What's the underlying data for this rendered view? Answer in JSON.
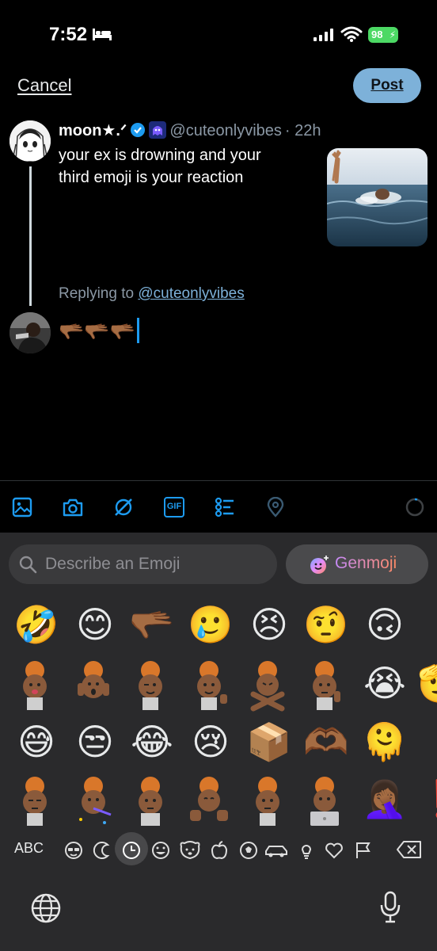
{
  "status_bar": {
    "time": "7:52",
    "battery": "98",
    "icons": [
      "bed-icon",
      "signal-icon",
      "wifi-icon",
      "battery-icon"
    ]
  },
  "header": {
    "cancel_label": "Cancel",
    "post_label": "Post"
  },
  "tweet": {
    "display_name": "moon★.ᐟ",
    "handle": "@cuteonlyvibes",
    "time_ago": "· 22h",
    "text_line1": "your ex is drowning and your",
    "text_line2": "third emoji is your reaction",
    "replying_prefix": "Replying to",
    "replying_handle": "@cuteonlyvibes"
  },
  "reply": {
    "text": "🫳🏾🫳🏾🫳🏾"
  },
  "toolbar": {
    "icons": [
      "image-icon",
      "camera-icon",
      "grok-icon",
      "gif-icon",
      "poll-icon",
      "location-icon",
      "character-count-ring"
    ],
    "gif_label": "GIF"
  },
  "keyboard": {
    "search_placeholder": "Describe an Emoji",
    "genmoji_label": "Genmoji",
    "abc_label": "ABC",
    "emoji_rows": [
      [
        "🤣",
        "😊",
        "🫳🏾",
        "🥲",
        "😣",
        "🤨",
        "🙃"
      ],
      [
        "memoji",
        "memoji",
        "memoji",
        "memoji",
        "memoji",
        "memoji",
        "😭",
        "🫡"
      ],
      [
        "😅",
        "😒",
        "😂",
        "😢",
        "📦",
        "🫶🏾",
        "🫠"
      ],
      [
        "memoji",
        "memoji",
        "memoji",
        "memoji",
        "memoji",
        "memoji",
        "🤦🏾‍♀️",
        "❗"
      ]
    ],
    "categories": [
      "memoji-icon",
      "stickers-icon",
      "recent-icon",
      "smileys-icon",
      "animals-icon",
      "food-icon",
      "activity-icon",
      "travel-icon",
      "objects-icon",
      "symbols-icon",
      "flags-icon"
    ],
    "active_category": "recent-icon"
  },
  "colors": {
    "accent": "#1d9bf0",
    "post_button": "#7db1d9",
    "keyboard_bg": "#2a2a2c",
    "battery": "#4cd964"
  }
}
